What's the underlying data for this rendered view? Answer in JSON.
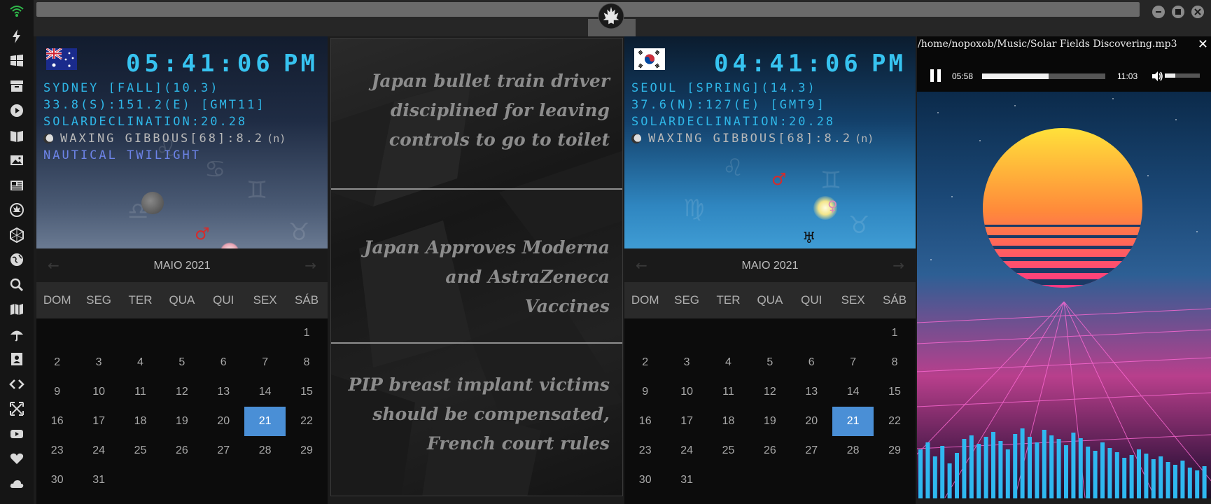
{
  "sidebar": {
    "icons": [
      "wifi-icon",
      "bolt-icon",
      "windows-icon",
      "archive-icon",
      "play-circle-icon",
      "book-icon",
      "image-icon",
      "newspaper-icon",
      "rebel-icon",
      "hexagon-icon",
      "globe-icon",
      "search-icon",
      "map-icon",
      "umbrella-icon",
      "contacts-icon",
      "code-icon",
      "fullscreen-icon",
      "youtube-icon",
      "heart-icon",
      "cloud-icon"
    ],
    "accent": "#d9d9d9"
  },
  "clocks": [
    {
      "country": "Australia",
      "time": "05:41:06",
      "ampm": "PM",
      "location": "SYDNEY [FALL](10.3)",
      "coords": "33.8(S):151.2(E) [GMT11]",
      "solar": "SOLARDECLINATION:20.28",
      "moon": "WAXING GIBBOUS[68]:8.2",
      "moon_suffix": "(n)",
      "twilight": "NAUTICAL TWILIGHT"
    },
    {
      "country": "South Korea",
      "time": "04:41:06",
      "ampm": "PM",
      "location": "SEOUL [SPRING](14.3)",
      "coords": "37.6(N):127(E) [GMT9]",
      "solar": "SOLARDECLINATION:20.28",
      "moon": "WAXING GIBBOUS[68]:8.2",
      "moon_suffix": "(n)"
    }
  ],
  "calendar": {
    "month": "MAIO 2021",
    "prev": "←",
    "next": "→",
    "weekdays": [
      "DOM",
      "SEG",
      "TER",
      "QUA",
      "QUI",
      "SEX",
      "SÁB"
    ],
    "weeks": [
      [
        "",
        "",
        "",
        "",
        "",
        "",
        "1"
      ],
      [
        "2",
        "3",
        "4",
        "5",
        "6",
        "7",
        "8"
      ],
      [
        "9",
        "10",
        "11",
        "12",
        "13",
        "14",
        "15"
      ],
      [
        "16",
        "17",
        "18",
        "19",
        "20",
        "21",
        "22"
      ],
      [
        "23",
        "24",
        "25",
        "26",
        "27",
        "28",
        "29"
      ],
      [
        "30",
        "31",
        "",
        "",
        "",
        "",
        ""
      ]
    ],
    "today": "21",
    "today_color": "#4a8fd6"
  },
  "news": [
    "Japan bullet train driver disciplined for leaving controls to go to toilet",
    "Japan Approves Moderna and AstraZeneca Vaccines",
    "PIP breast implant victims should be compensated, French court rules"
  ],
  "player": {
    "path": "/home/nopoxob/Music/Solar Fields Discovering.mp3",
    "close": "✕",
    "elapsed": "05:58",
    "duration": "11:03",
    "progress": 0.54,
    "volume": 0.3
  }
}
